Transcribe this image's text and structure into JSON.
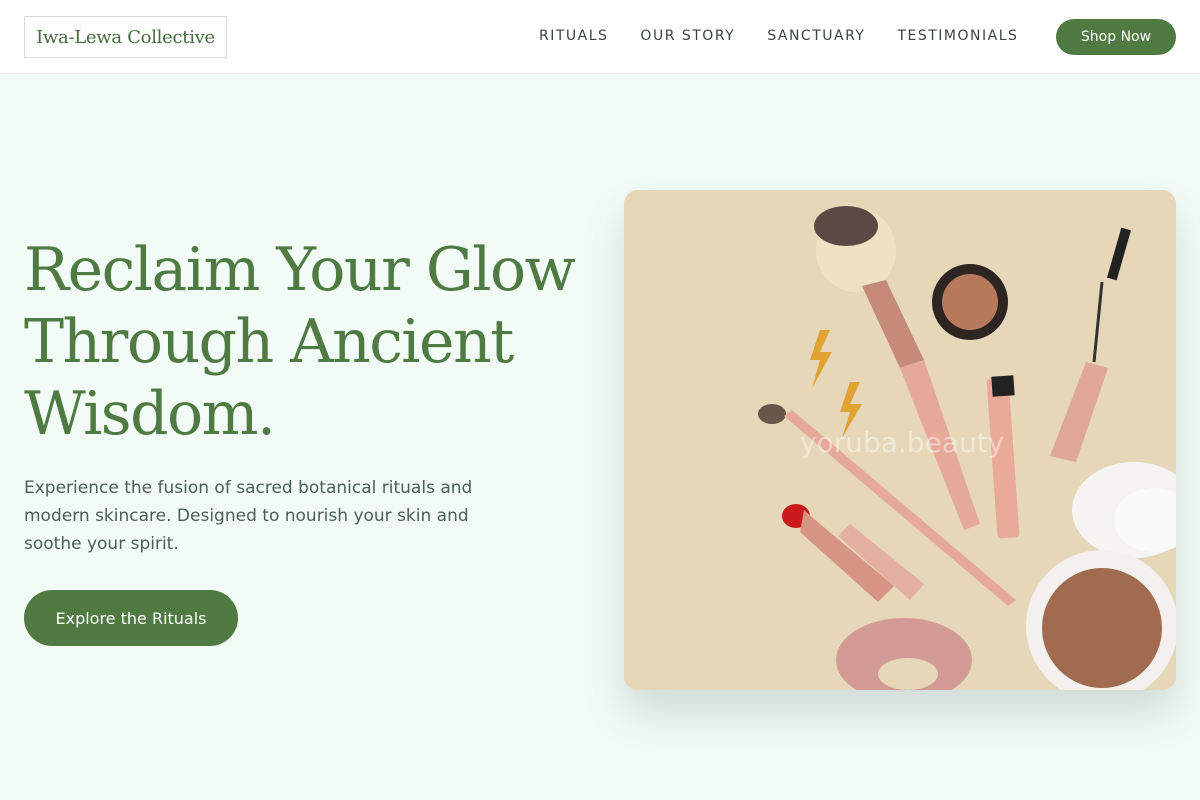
{
  "header": {
    "logo": "Iwa-Lewa Collective",
    "nav": [
      "RITUALS",
      "OUR STORY",
      "SANCTUARY",
      "TESTIMONIALS"
    ],
    "shop_label": "Shop Now"
  },
  "hero": {
    "title_lines": [
      "Reclaim Your Glow",
      "Through Ancient",
      "Wisdom."
    ],
    "description": "Experience the fusion of sacred botanical rituals and modern skincare. Designed to nourish your skin and soothe your spirit.",
    "cta_label": "Explore the Rituals",
    "image_watermark": "yoruba.beauty"
  },
  "colors": {
    "brand_green": "#4f7a42",
    "page_bg": "#f3fbf7",
    "image_bg": "#e5d7b7"
  }
}
